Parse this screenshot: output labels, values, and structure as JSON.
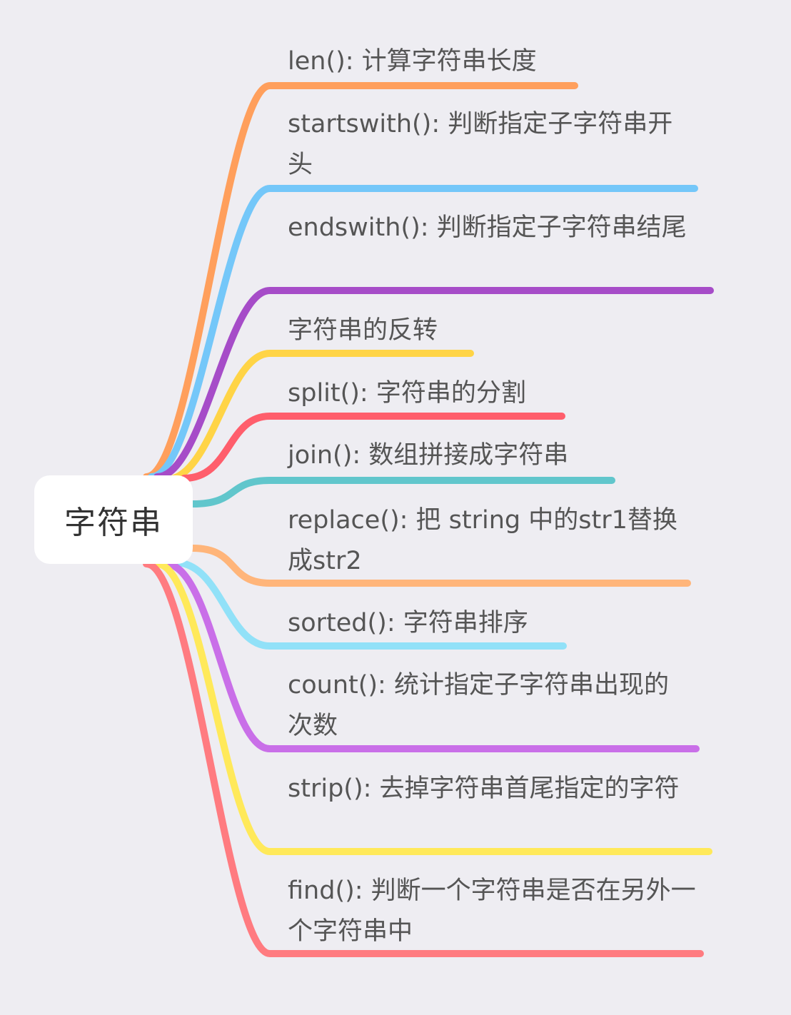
{
  "mindmap": {
    "root": {
      "label": "字符串"
    },
    "branches": [
      {
        "label": "len(): 计算字符串长度",
        "color": "#ff9f5c"
      },
      {
        "label": "startswith(): 判断指定子字符串开头",
        "color": "#74c7f9"
      },
      {
        "label": "endswith(): 判断指定子字符串结尾",
        "color": "#a64cc8"
      },
      {
        "label": "字符串的反转",
        "color": "#ffd446"
      },
      {
        "label": "split(): 字符串的分割",
        "color": "#ff5e6c"
      },
      {
        "label": "join(): 数组拼接成字符串",
        "color": "#61c6cc"
      },
      {
        "label": "replace(): 把 string 中的str1替换成str2",
        "color": "#ffb57a"
      },
      {
        "label": "sorted(): 字符串排序",
        "color": "#91e1f8"
      },
      {
        "label": "count(): 统计指定子字符串出现的次数",
        "color": "#c96fe8"
      },
      {
        "label": "strip(): 去掉字符串首尾指定的字符",
        "color": "#ffe95a"
      },
      {
        "label": "find(): 判断一个字符串是否在另外一个字符串中",
        "color": "#ff7b80"
      }
    ]
  }
}
